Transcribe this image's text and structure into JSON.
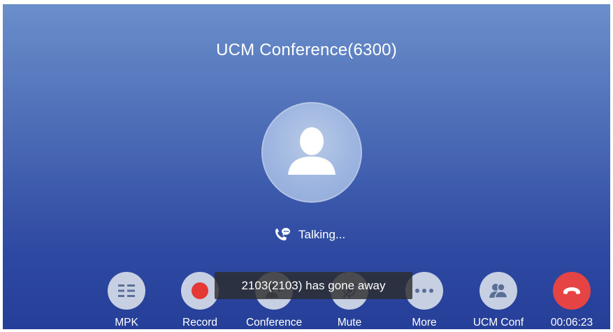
{
  "call": {
    "title": "UCM Conference(6300)",
    "status": "Talking...",
    "toast": "2103(2103) has gone away",
    "duration": "00:06:23"
  },
  "buttons": {
    "mpk": "MPK",
    "record": "Record",
    "conference": "Conference",
    "mute": "Mute",
    "more": "More",
    "ucm_conf": "UCM Conf"
  },
  "colors": {
    "background_top": "#6a8fcb",
    "background_bottom": "#263f99",
    "record_dot": "#e53935",
    "hangup": "#e64444",
    "button_bg": "#c7d0e2",
    "icon": "#5a6f95"
  },
  "icons": {
    "mpk": "grid-list-icon",
    "record": "record-dot-icon",
    "conference": "conference-add-icon",
    "mute": "microphone-off-icon",
    "more": "more-dots-icon",
    "ucm_conf": "group-users-icon",
    "hangup": "end-call-icon",
    "status": "phone-chat-icon",
    "avatar": "person-silhouette-icon"
  }
}
